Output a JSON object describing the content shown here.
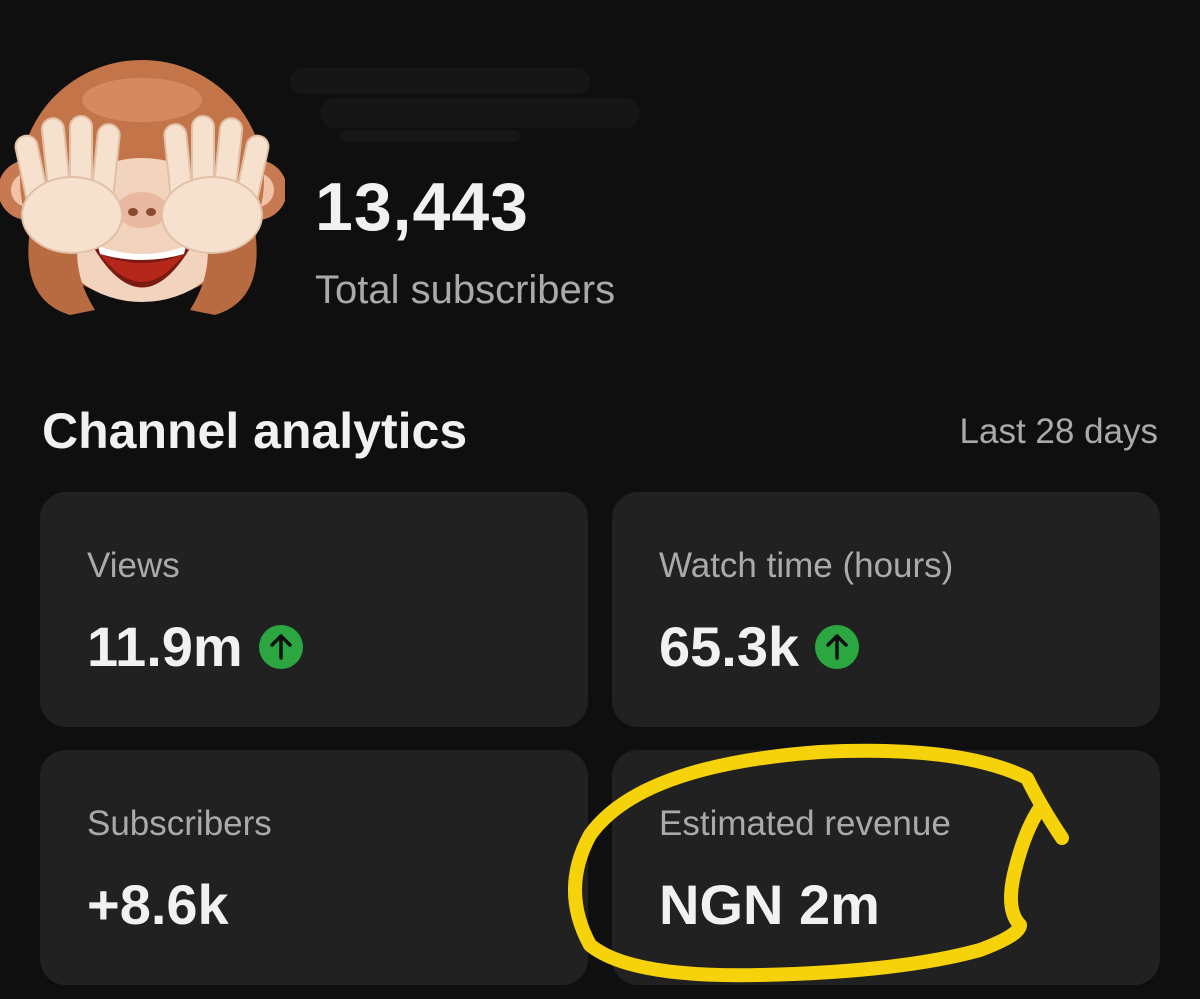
{
  "channel": {
    "avatar_icon": "see-no-evil-monkey-icon",
    "subscriber_count": "13,443",
    "subscriber_label": "Total subscribers"
  },
  "analytics": {
    "title": "Channel analytics",
    "period": "Last 28 days",
    "cards": [
      {
        "label": "Views",
        "value": "11.9m",
        "trend": "up",
        "trend_icon": "arrow-up-circle-icon"
      },
      {
        "label": "Watch time (hours)",
        "value": "65.3k",
        "trend": "up",
        "trend_icon": "arrow-up-circle-icon"
      },
      {
        "label": "Subscribers",
        "value": "+8.6k"
      },
      {
        "label": "Estimated revenue",
        "value": "NGN 2m"
      }
    ]
  },
  "colors": {
    "background": "#0f0f0f",
    "card": "#212121",
    "trend_up": "#2ba640",
    "highlight_scribble": "#f5d20a"
  }
}
